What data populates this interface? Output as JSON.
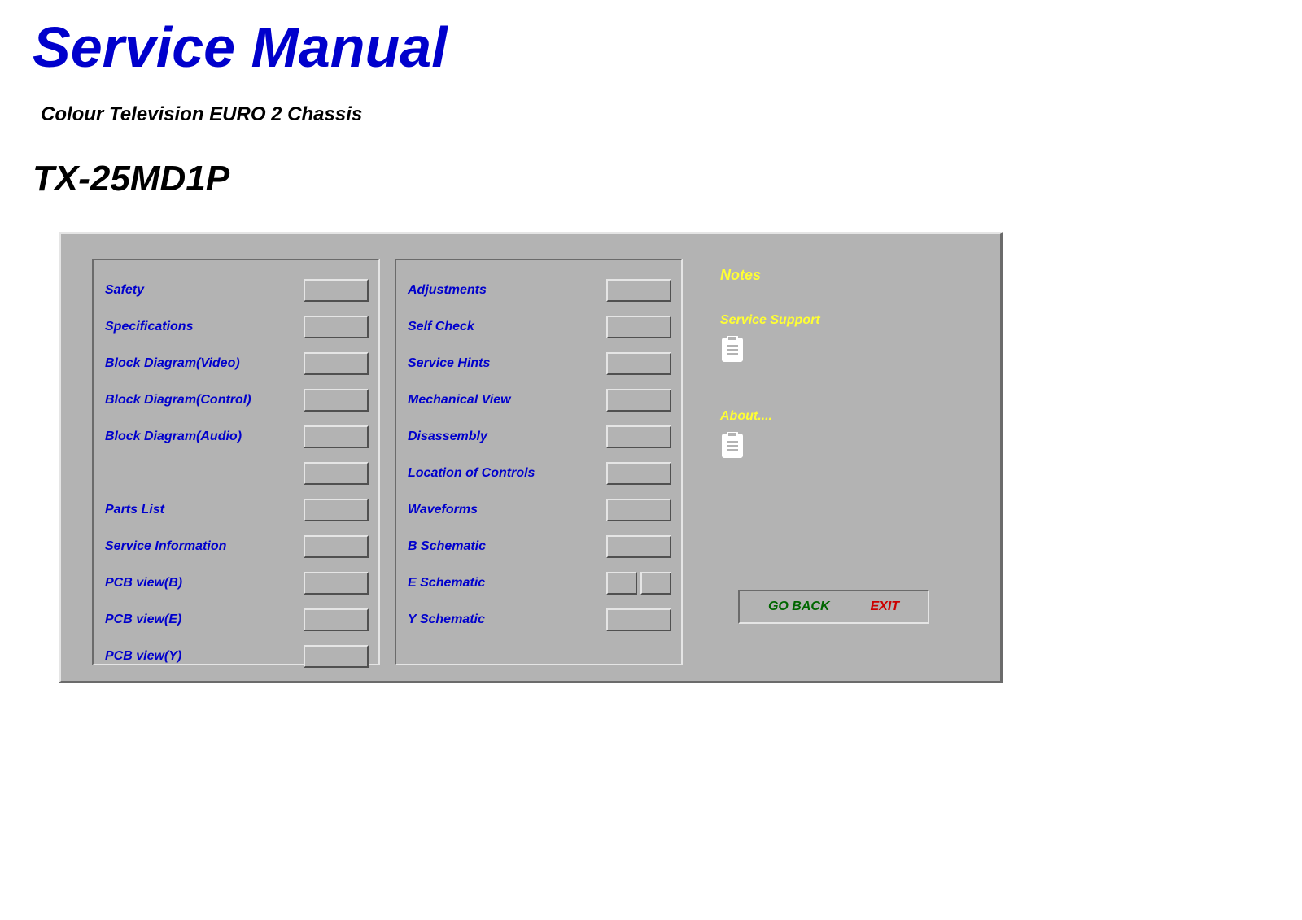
{
  "header": {
    "title": "Service Manual",
    "subtitle": "Colour Television EURO 2 Chassis",
    "model": "TX-25MD1P"
  },
  "left_column": [
    {
      "label": "Safety"
    },
    {
      "label": "Specifications"
    },
    {
      "label": "Block Diagram(Video)"
    },
    {
      "label": "Block Diagram(Control)"
    },
    {
      "label": "Block Diagram(Audio)"
    },
    {
      "label": ""
    },
    {
      "label": "Parts List"
    },
    {
      "label": "Service Information"
    },
    {
      "label": "PCB view(B)"
    },
    {
      "label": "PCB view(E)"
    },
    {
      "label": "PCB view(Y)"
    }
  ],
  "middle_column": [
    {
      "label": "Adjustments"
    },
    {
      "label": "Self Check"
    },
    {
      "label": "Service Hints"
    },
    {
      "label": "Mechanical View"
    },
    {
      "label": "Disassembly"
    },
    {
      "label": "Location of Controls"
    },
    {
      "label": "Waveforms"
    },
    {
      "label": "B Schematic"
    },
    {
      "label": "E Schematic",
      "split": true
    },
    {
      "label": "Y Schematic"
    }
  ],
  "right_column": {
    "notes": "Notes",
    "service_support": "Service Support",
    "about": "About....",
    "go_back": "GO BACK",
    "exit": "EXIT"
  }
}
